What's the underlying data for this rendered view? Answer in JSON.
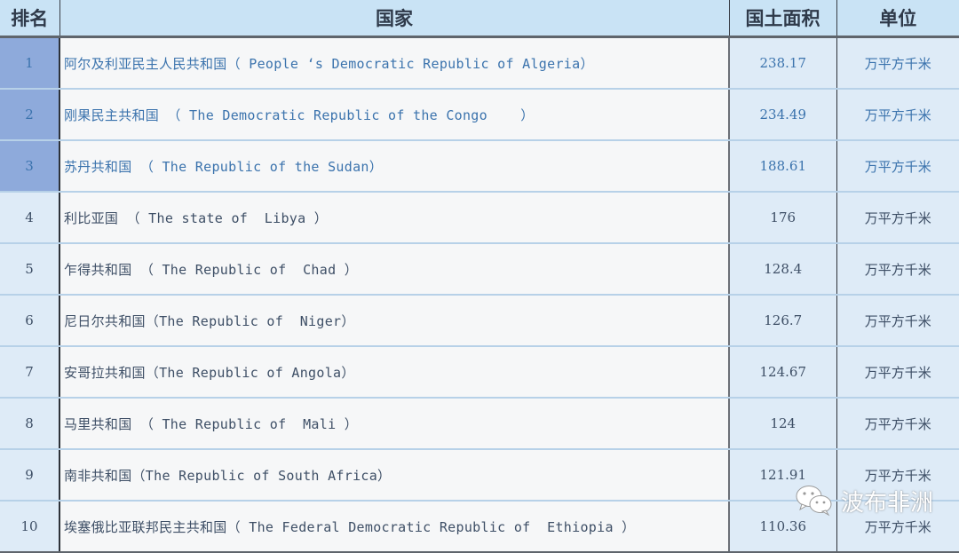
{
  "header": {
    "rank": "排名",
    "country": "国家",
    "area": "国土面积",
    "unit": "单位"
  },
  "rows": [
    {
      "rank": "1",
      "country": "阿尔及利亚民主人民共和国（ People ‘s Democratic Republic of Algeria）",
      "area": "238.17",
      "unit": "万平方千米",
      "highlight": true
    },
    {
      "rank": "2",
      "country": "刚果民主共和国 （ The Democratic Republic of the Congo    ）",
      "area": "234.49",
      "unit": "万平方千米",
      "highlight": true
    },
    {
      "rank": "3",
      "country": "苏丹共和国 （ The Republic of the Sudan）",
      "area": "188.61",
      "unit": "万平方千米",
      "highlight": true
    },
    {
      "rank": "4",
      "country": "利比亚国 （ The state of  Libya ）",
      "area": "176",
      "unit": "万平方千米",
      "highlight": false
    },
    {
      "rank": "5",
      "country": "乍得共和国 （ The Republic of  Chad ）",
      "area": "128.4",
      "unit": "万平方千米",
      "highlight": false
    },
    {
      "rank": "6",
      "country": "尼日尔共和国（The Republic of  Niger）",
      "area": "126.7",
      "unit": "万平方千米",
      "highlight": false
    },
    {
      "rank": "7",
      "country": "安哥拉共和国（The Republic of Angola）",
      "area": "124.67",
      "unit": "万平方千米",
      "highlight": false
    },
    {
      "rank": "8",
      "country": "马里共和国 （ The Republic of  Mali ）",
      "area": "124",
      "unit": "万平方千米",
      "highlight": false
    },
    {
      "rank": "9",
      "country": "南非共和国（The Republic of South Africa）",
      "area": "121.91",
      "unit": "万平方千米",
      "highlight": false
    },
    {
      "rank": "10",
      "country": "埃塞俄比亚联邦民主共和国（ The Federal Democratic Republic of  Ethiopia ）",
      "area": "110.36",
      "unit": "万平方千米",
      "highlight": false
    }
  ],
  "watermark": {
    "icon": "wechat-icon",
    "text": "波布非洲"
  }
}
